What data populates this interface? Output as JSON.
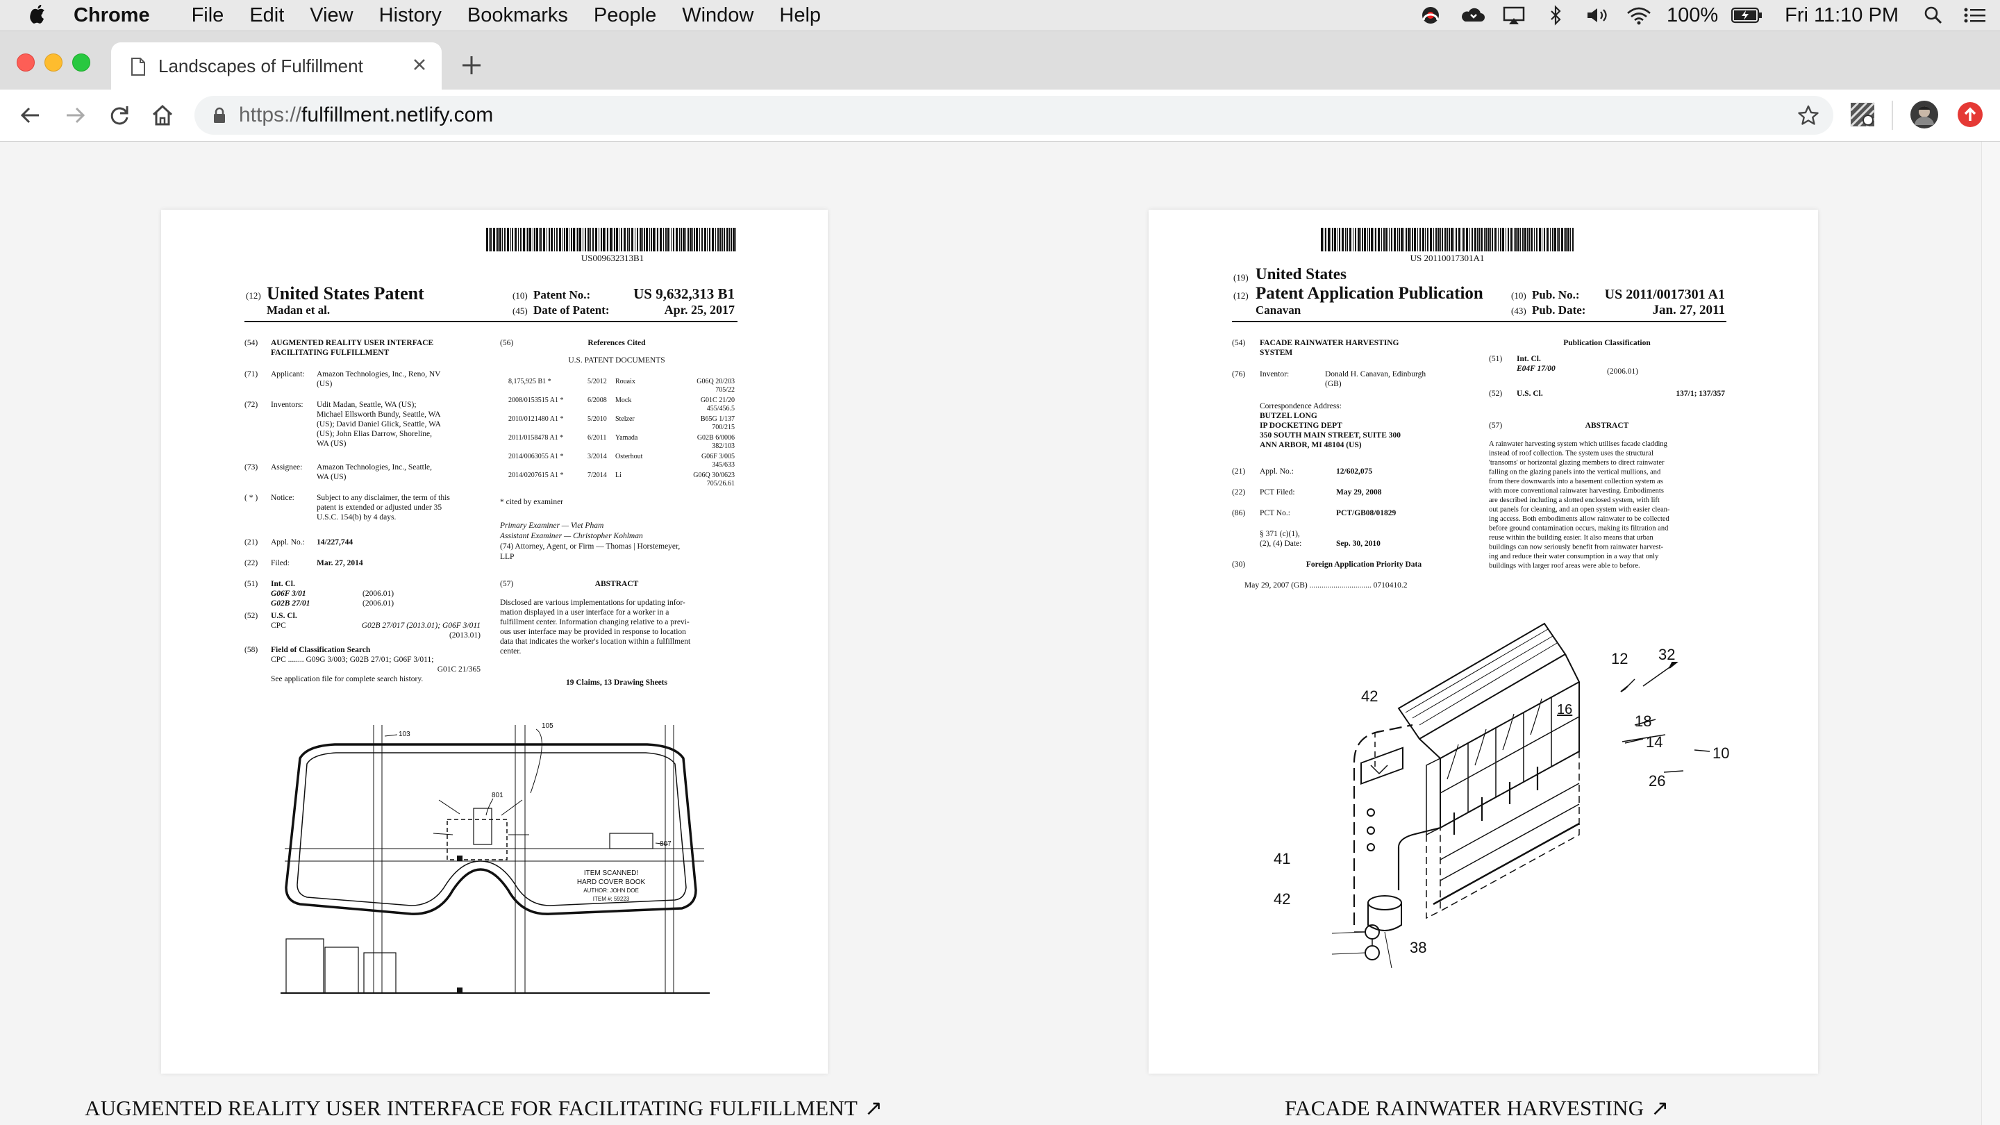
{
  "menubar": {
    "app_name": "Chrome",
    "items": [
      "File",
      "Edit",
      "View",
      "History",
      "Bookmarks",
      "People",
      "Window",
      "Help"
    ],
    "battery": "100%",
    "clock": "Fri 11:10 PM"
  },
  "tab": {
    "title": "Landscapes of Fulfillment"
  },
  "toolbar": {
    "url_scheme": "https://",
    "url_host": "fulfillment.netlify.com"
  },
  "patent_left": {
    "barcode_number": "US009632313B1",
    "type_code": "(12)",
    "type": "United States Patent",
    "inventor_short": "Madan et al.",
    "patent_no_code": "(10)",
    "patent_no_label": "Patent No.:",
    "patent_no": "US 9,632,313 B1",
    "date_code": "(45)",
    "date_label": "Date of Patent:",
    "date": "Apr. 25, 2017",
    "title_code": "(54)",
    "title_lines": [
      "AUGMENTED REALITY USER INTERFACE",
      "FACILITATING FULFILLMENT"
    ],
    "applicant_code": "(71)",
    "applicant_label": "Applicant:",
    "applicant": "Amazon Technologies, Inc., Reno, NV",
    "applicant_line2": "(US)",
    "inventors_code": "(72)",
    "inventors_label": "Inventors:",
    "inventors_lines": [
      "Udit Madan, Seattle, WA (US);",
      "Michael Ellsworth Bundy, Seattle, WA",
      "(US); David Daniel Glick, Seattle, WA",
      "(US); John Elias Darrow, Shoreline,",
      "WA (US)"
    ],
    "assignee_code": "(73)",
    "assignee_label": "Assignee:",
    "assignee_lines": [
      "Amazon Technologies, Inc., Seattle,",
      "WA (US)"
    ],
    "notice_code": "( * )",
    "notice_label": "Notice:",
    "notice_lines": [
      "Subject to any disclaimer, the term of this",
      "patent is extended or adjusted under 35",
      "U.S.C. 154(b) by 4 days."
    ],
    "appl_code": "(21)",
    "appl_label": "Appl. No.:",
    "appl_no": "14/227,744",
    "filed_code": "(22)",
    "filed_label": "Filed:",
    "filed": "Mar. 27, 2014",
    "intcl_code": "(51)",
    "intcl_label": "Int. Cl.",
    "intcl_rows": [
      [
        "G06F 3/01",
        "(2006.01)"
      ],
      [
        "G02B 27/01",
        "(2006.01)"
      ]
    ],
    "uscl_code": "(52)",
    "uscl_label": "U.S. Cl.",
    "cpc_label": "CPC",
    "cpc_value": "G02B 27/017 (2013.01); G06F 3/011",
    "cpc_value2": "(2013.01)",
    "field_code": "(58)",
    "field_label": "Field of Classification Search",
    "field_cpc": "CPC ........ G09G 3/003; G02B 27/01; G06F 3/011;",
    "field_cpc2": "G01C 21/365",
    "field_note": "See application file for complete search history.",
    "ref_code": "(56)",
    "ref_title": "References Cited",
    "ref_subtitle": "U.S. PATENT DOCUMENTS",
    "references": [
      [
        "8,175,925 B1 *",
        "5/2012",
        "Rouaix",
        "G06Q 20/203",
        "705/22"
      ],
      [
        "2008/0153515 A1 *",
        "6/2008",
        "Mock",
        "G01C 21/20",
        "455/456.5"
      ],
      [
        "2010/0121480 A1 *",
        "5/2010",
        "Stelzer",
        "B65G 1/137",
        "700/215"
      ],
      [
        "2011/0158478 A1 *",
        "6/2011",
        "Yamada",
        "G02B 6/0006",
        "382/103"
      ],
      [
        "2014/0063055 A1 *",
        "3/2014",
        "Osterhout",
        "G06F 3/005",
        "345/633"
      ],
      [
        "2014/0207615 A1 *",
        "7/2014",
        "Li",
        "G06Q 30/0623",
        "705/26.61"
      ]
    ],
    "cited_note": "* cited by examiner",
    "primary_examiner": "Primary Examiner — Viet Pham",
    "assistant_examiner": "Assistant Examiner — Christopher Kohlman",
    "attorney": "(74) Attorney, Agent, or Firm — Thomas | Horstemeyer,",
    "attorney2": "LLP",
    "abstract_code": "(57)",
    "abstract_title": "ABSTRACT",
    "abstract_lines": [
      "Disclosed are various implementations for updating infor-",
      "mation displayed in a user interface for a worker in a",
      "fulfillment center. Information changing relative to a previ-",
      "ous user interface may be provided in response to location",
      "data that indicates the worker's location within a fulfillment",
      "center."
    ],
    "claims": "19 Claims, 13 Drawing Sheets",
    "drawing_labels": [
      "103",
      "105",
      "801",
      "807"
    ],
    "drawing_text": [
      "ITEM SCANNED!",
      "HARD COVER BOOK",
      "AUTHOR: JOHN DOE",
      "ITEM #: 59223"
    ]
  },
  "patent_right": {
    "barcode_number": "US 20110017301A1",
    "country_code": "(19)",
    "country": "United States",
    "type_code": "(12)",
    "type": "Patent Application Publication",
    "inventor_short": "Canavan",
    "pub_no_code": "(10)",
    "pub_no_label": "Pub. No.:",
    "pub_no": "US 2011/0017301 A1",
    "pub_date_code": "(43)",
    "pub_date_label": "Pub. Date:",
    "pub_date": "Jan. 27, 2011",
    "title_code": "(54)",
    "title_lines": [
      "FACADE RAINWATER HARVESTING",
      "SYSTEM"
    ],
    "inventor_code": "(76)",
    "inventor_label": "Inventor:",
    "inventor": "Donald H. Canavan, Edinburgh",
    "inventor2": "(GB)",
    "corr_label": "Correspondence Address:",
    "corr_lines": [
      "BUTZEL LONG",
      "IP DOCKETING DEPT",
      "350 SOUTH MAIN STREET, SUITE 300",
      "ANN ARBOR, MI 48104 (US)"
    ],
    "appl_code": "(21)",
    "appl_label": "Appl. No.:",
    "appl_no": "12/602,075",
    "pct_filed_code": "(22)",
    "pct_filed_label": "PCT Filed:",
    "pct_filed": "May 29, 2008",
    "pct_no_code": "(86)",
    "pct_no_label": "PCT No.:",
    "pct_no": "PCT/GB08/01829",
    "s371_line1": "§ 371 (c)(1),",
    "s371_line2": "(2), (4) Date:",
    "s371_date": "Sep. 30, 2010",
    "priority_code": "(30)",
    "priority_title": "Foreign Application Priority Data",
    "priority_row": "May 29, 2007    (GB) ............................... 0710410.2",
    "pubclass_title": "Publication Classification",
    "intcl_code": "(51)",
    "intcl_label": "Int. Cl.",
    "intcl_value": "E04F 17/00",
    "intcl_year": "(2006.01)",
    "uscl_code": "(52)",
    "uscl_label": "U.S. Cl.",
    "uscl_value": "137/1; 137/357",
    "abstract_code": "(57)",
    "abstract_title": "ABSTRACT",
    "abstract_lines": [
      "A rainwater harvesting system which utilises facade cladding",
      "instead of roof collection. The system uses the structural",
      "'transoms' or horizontal glazing members to direct rainwater",
      "falling on the glazing panels into the vertical mullions, and",
      "from there downwards into a basement collection system as",
      "with more conventional rainwater harvesting. Embodiments",
      "are described including a slotted enclosed system, with lift",
      "out panels for cleaning, and an open system with easier clean-",
      "ing access. Both embodiments allow rainwater to be collected",
      "before ground contamination occurs, making its filtration and",
      "reuse within the building easier. It also means that urban",
      "buildings can now seriously benefit from rainwater harvest-",
      "ing and reduce their water consumption in a way that only",
      "buildings with larger roof areas were able to before."
    ],
    "drawing_labels": [
      "12",
      "32",
      "42",
      "16",
      "18",
      "14",
      "10",
      "26",
      "41",
      "42",
      "38"
    ]
  },
  "captions": {
    "left": "AUGMENTED REALITY USER INTERFACE FOR FACILITATING FULFILLMENT",
    "right": "FACADE RAINWATER HARVESTING",
    "arrow": "↗"
  }
}
